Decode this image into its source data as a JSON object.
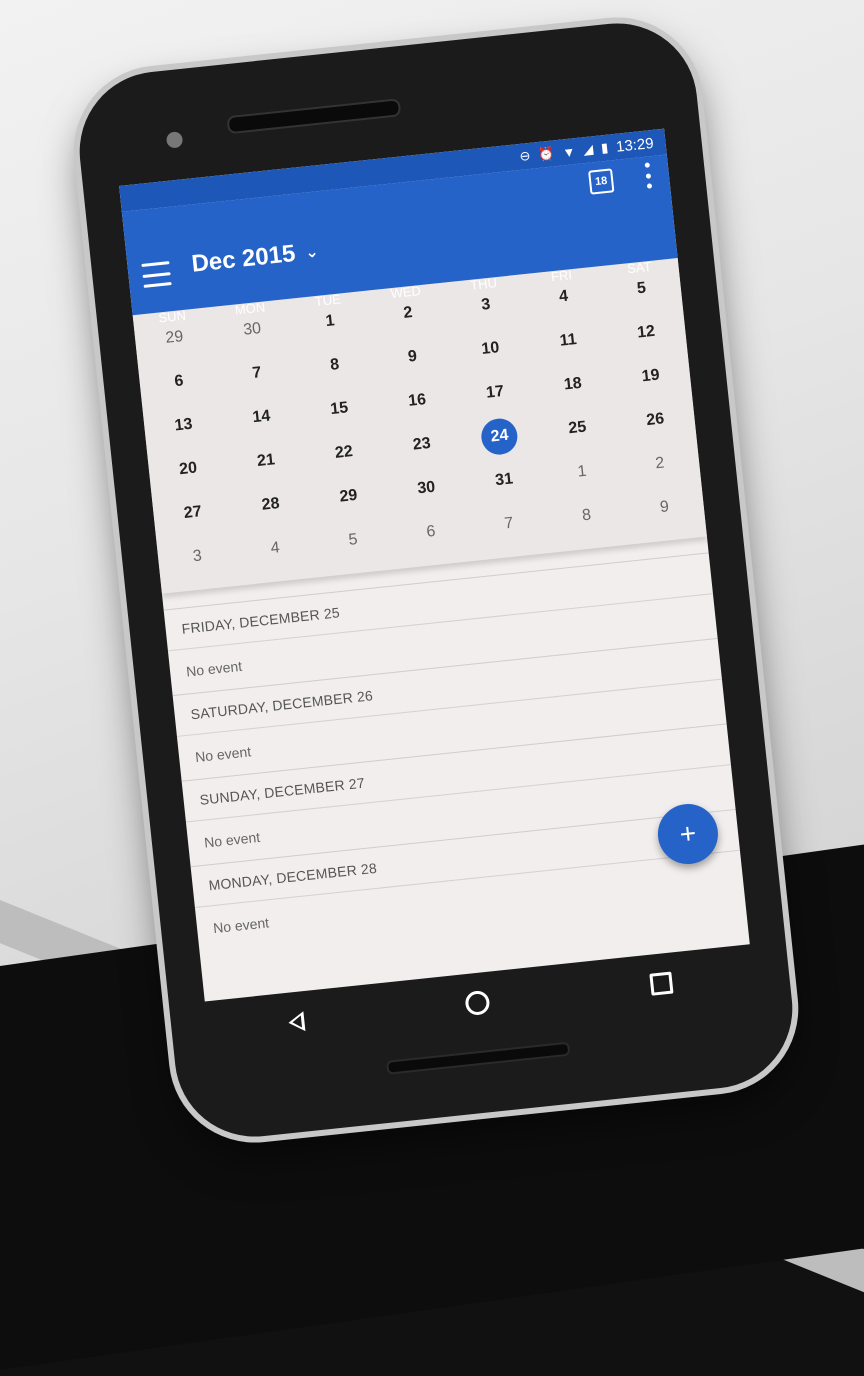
{
  "status_bar": {
    "time": "13:29",
    "icons": [
      "do-not-disturb-icon",
      "alarm-icon",
      "wifi-icon",
      "signal-icon",
      "battery-icon"
    ]
  },
  "app_bar": {
    "month_title": "Dec 2015",
    "today_icon_label": "18",
    "colors": {
      "primary": "#2563c9",
      "status": "#1d57b8"
    }
  },
  "weekdays": [
    "SUN",
    "MON",
    "TUE",
    "WED",
    "THU",
    "FRI",
    "SAT"
  ],
  "calendar": {
    "weeks": [
      [
        {
          "d": "29",
          "m": true
        },
        {
          "d": "30",
          "m": true
        },
        {
          "d": "1"
        },
        {
          "d": "2"
        },
        {
          "d": "3"
        },
        {
          "d": "4"
        },
        {
          "d": "5"
        }
      ],
      [
        {
          "d": "6"
        },
        {
          "d": "7"
        },
        {
          "d": "8"
        },
        {
          "d": "9"
        },
        {
          "d": "10"
        },
        {
          "d": "11"
        },
        {
          "d": "12"
        }
      ],
      [
        {
          "d": "13"
        },
        {
          "d": "14"
        },
        {
          "d": "15"
        },
        {
          "d": "16"
        },
        {
          "d": "17"
        },
        {
          "d": "18"
        },
        {
          "d": "19"
        }
      ],
      [
        {
          "d": "20"
        },
        {
          "d": "21"
        },
        {
          "d": "22"
        },
        {
          "d": "23"
        },
        {
          "d": "24",
          "today": true
        },
        {
          "d": "25"
        },
        {
          "d": "26"
        }
      ],
      [
        {
          "d": "27"
        },
        {
          "d": "28"
        },
        {
          "d": "29"
        },
        {
          "d": "30"
        },
        {
          "d": "31"
        },
        {
          "d": "1",
          "m": true
        },
        {
          "d": "2",
          "m": true
        }
      ],
      [
        {
          "d": "3",
          "m": true
        },
        {
          "d": "4",
          "m": true
        },
        {
          "d": "5",
          "m": true
        },
        {
          "d": "6",
          "m": true
        },
        {
          "d": "7",
          "m": true
        },
        {
          "d": "8",
          "m": true
        },
        {
          "d": "9",
          "m": true
        }
      ]
    ]
  },
  "agenda": [
    {
      "date": "FRIDAY, DECEMBER 25",
      "event": "No event"
    },
    {
      "date": "SATURDAY, DECEMBER 26",
      "event": "No event"
    },
    {
      "date": "SUNDAY, DECEMBER 27",
      "event": "No event"
    },
    {
      "date": "MONDAY, DECEMBER 28",
      "event": "No event"
    }
  ],
  "fab": {
    "label": "+"
  }
}
